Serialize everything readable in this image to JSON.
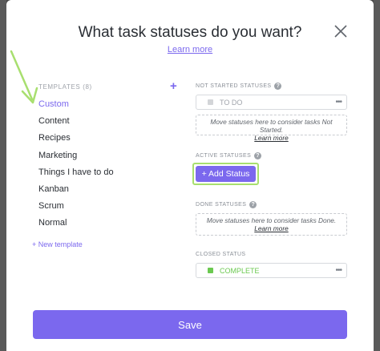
{
  "modal": {
    "title": "What task statuses do you want?",
    "learn_more": "Learn more"
  },
  "templates": {
    "heading": "TEMPLATES (8)",
    "items": [
      {
        "label": "Custom",
        "active": true
      },
      {
        "label": "Content"
      },
      {
        "label": "Recipes"
      },
      {
        "label": "Marketing"
      },
      {
        "label": "Things I have to do"
      },
      {
        "label": "Kanban"
      },
      {
        "label": "Scrum"
      },
      {
        "label": "Normal"
      }
    ],
    "new_template": "+ New template"
  },
  "statuses": {
    "not_started": {
      "heading": "NOT STARTED STATUSES",
      "item": {
        "label": "TO DO",
        "color": "#d3d5d8"
      },
      "drop_hint_1": "Move statuses here to consider tasks Not Started.",
      "drop_hint_2": "Learn more"
    },
    "active": {
      "heading": "ACTIVE STATUSES",
      "add_label": "+ Add Status"
    },
    "done": {
      "heading": "DONE STATUSES",
      "drop_hint_1": "Move statuses here to consider tasks Done.",
      "drop_hint_2": "Learn more"
    },
    "closed": {
      "heading": "CLOSED STATUS",
      "item": {
        "label": "COMPLETE",
        "color": "#6bc950"
      }
    }
  },
  "footer": {
    "save_label": "Save"
  },
  "colors": {
    "accent": "#7b68ee",
    "highlight": "#a8df6f"
  },
  "icons": {
    "close": "close-icon",
    "add_template": "plus-icon",
    "help": "help-icon",
    "menu": "ellipsis-icon",
    "annotation": "arrow-icon"
  }
}
